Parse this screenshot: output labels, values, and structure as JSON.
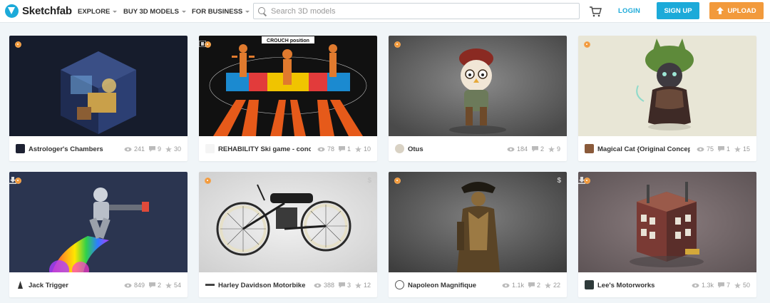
{
  "header": {
    "logo_text": "Sketchfab",
    "nav": [
      "EXPLORE",
      "BUY 3D MODELS",
      "FOR BUSINESS"
    ],
    "search_placeholder": "Search 3D models",
    "login_label": "LOGIN",
    "signup_label": "SIGN UP",
    "upload_label": "UPLOAD",
    "accent_color": "#1caad9",
    "upload_color": "#f29a3c"
  },
  "cards": [
    {
      "title": "Astrologer's Chambers",
      "views": "241",
      "comments": "9",
      "likes": "30",
      "corner_icon": ""
    },
    {
      "title": "REHABILITY Ski game - concept",
      "views": "78",
      "comments": "1",
      "likes": "10",
      "corner_icon": "film-icon",
      "thumb_text": "CROUCH position"
    },
    {
      "title": "Otus",
      "views": "184",
      "comments": "2",
      "likes": "9",
      "corner_icon": ""
    },
    {
      "title": "Magical Cat {Original Concept b",
      "views": "75",
      "comments": "1",
      "likes": "15",
      "corner_icon": ""
    },
    {
      "title": "Jack Trigger",
      "views": "849",
      "comments": "2",
      "likes": "54",
      "corner_icon": "download-icon"
    },
    {
      "title": "Harley Davidson Motorbike",
      "views": "388",
      "comments": "3",
      "likes": "12",
      "corner_icon": "dollar-icon",
      "corner_text": "$"
    },
    {
      "title": "Napoleon Magnifique",
      "views": "1.1k",
      "comments": "2",
      "likes": "22",
      "corner_icon": "dollar-icon",
      "corner_text": "$"
    },
    {
      "title": "Lee's Motorworks",
      "views": "1.3k",
      "comments": "7",
      "likes": "50",
      "corner_icon": "download-icon"
    }
  ]
}
